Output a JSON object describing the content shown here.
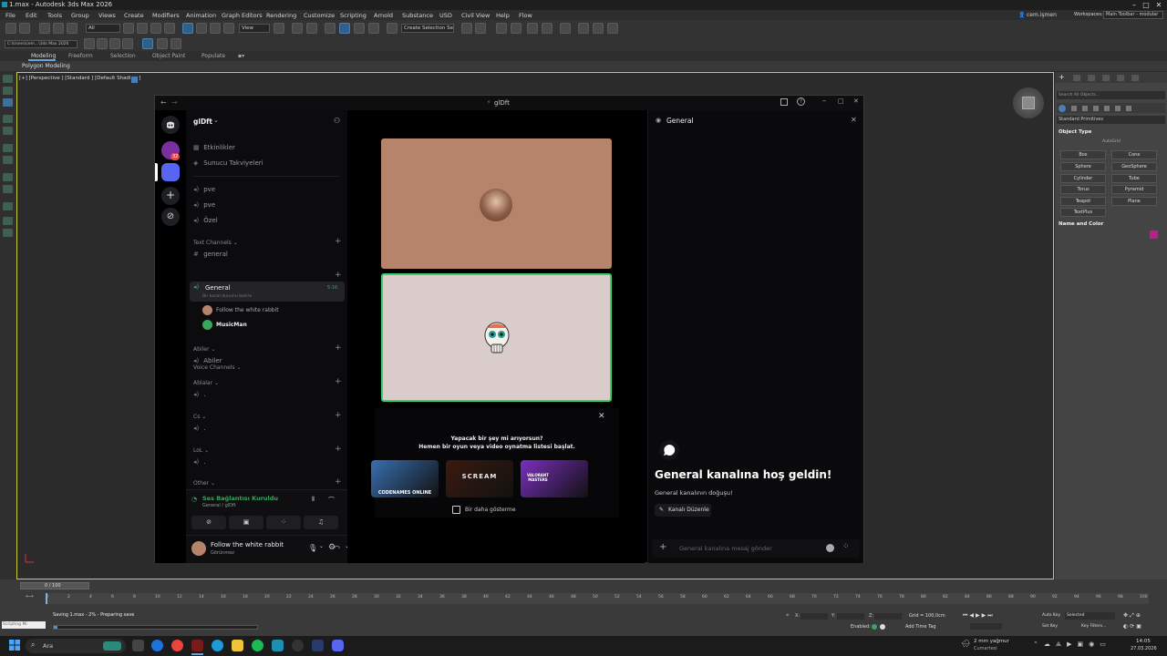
{
  "window": {
    "title": "1.max - Autodesk 3ds Max 2026",
    "minimize": "–",
    "maximize": "□",
    "close": "✕"
  },
  "menu": [
    "File",
    "Edit",
    "Tools",
    "Group",
    "Views",
    "Create",
    "Modifiers",
    "Animation",
    "Graph Editors",
    "Rendering",
    "Customize",
    "Scripting",
    "Arnold",
    "Substance",
    "USD",
    "Civil View",
    "Help",
    "Flow"
  ],
  "user": {
    "name": "cem.işmen",
    "workspaces_label": "Workspaces:",
    "workspace": "Main Toolbar - modular"
  },
  "toolbar": {
    "all_filter": "All",
    "view_dropdown": "View",
    "selection_set": "Create Selection Se",
    "path": "C:\\Users\\cem...\\3ds Max 2026"
  },
  "ribbon": {
    "tabs": [
      "Modeling",
      "Freeform",
      "Selection",
      "Object Paint",
      "Populate"
    ],
    "sub": "Polygon Modeling"
  },
  "viewport": {
    "label": "[+] [Perspective ] [Standard ] [Default Shading ]"
  },
  "command_panel": {
    "search_placeholder": "Search All Objects...",
    "category": "Standard Primitives",
    "object_type_title": "Object Type",
    "autogrid": "AutoGrid",
    "primitives": [
      "Box",
      "Cone",
      "Sphere",
      "GeoSphere",
      "Cylinder",
      "Tube",
      "Torus",
      "Pyramid",
      "Teapot",
      "Plane",
      "TextPlus"
    ],
    "name_color_title": "Name and Color",
    "color": "#c2199a"
  },
  "timeline": {
    "slider_label": "0 / 100",
    "ticks": [
      "0",
      "2",
      "4",
      "6",
      "8",
      "10",
      "12",
      "14",
      "16",
      "18",
      "20",
      "22",
      "24",
      "26",
      "28",
      "30",
      "32",
      "34",
      "36",
      "38",
      "40",
      "42",
      "44",
      "46",
      "48",
      "50",
      "52",
      "54",
      "56",
      "58",
      "60",
      "62",
      "64",
      "66",
      "68",
      "70",
      "72",
      "74",
      "76",
      "78",
      "80",
      "82",
      "84",
      "86",
      "88",
      "90",
      "92",
      "94",
      "96",
      "98",
      "100"
    ]
  },
  "status": {
    "scripting": "Scripting Mi",
    "saving": "Saving 1.max -  2% - Preparing save",
    "x_label": "X:",
    "y_label": "Y:",
    "z_label": "Z:",
    "grid": "Grid = 100,0cm",
    "enabled": "Enabled:",
    "add_time_tag": "Add Time Tag",
    "auto_key": "Auto Key",
    "set_key": "Set Key",
    "selected": "Selected",
    "key_filters": "Key Filters..."
  },
  "taskbar": {
    "search": "Ara",
    "weather": "2 mm yağmur",
    "weather_sub": "Cumartesi",
    "time": "14:05",
    "date": "27.03.2026"
  },
  "discord": {
    "title": "glDft",
    "server_name": "glDft",
    "badge": "32",
    "top_items": [
      {
        "icon": "calendar-icon",
        "label": "Etkinlikler"
      },
      {
        "icon": "boost-icon",
        "label": "Sunucu Takviyeleri"
      }
    ],
    "channels_top": [
      {
        "icon": "speaker-icon",
        "label": "pve"
      },
      {
        "icon": "speaker-icon",
        "label": "pve"
      },
      {
        "icon": "speaker-icon",
        "label": "Özel"
      }
    ],
    "text_category": "Text Channels",
    "text_channels": [
      "general"
    ],
    "voice_category": "Voice Channels",
    "voice_active": {
      "label": "General",
      "time": "5:16",
      "status": "Bir kanal durumu belirle"
    },
    "voice_members": [
      {
        "name": "Follow the white rabbit",
        "avatar_color": "#b5846b"
      },
      {
        "name": "MusicMan",
        "avatar_color": "#3ba55d"
      }
    ],
    "categories": [
      {
        "name": "Abiler",
        "channels": [
          "Abiler"
        ]
      },
      {
        "name": "Ablalar",
        "channels": [
          "."
        ]
      },
      {
        "name": "Cs",
        "channels": [
          "."
        ]
      },
      {
        "name": "LoL",
        "channels": [
          "."
        ]
      },
      {
        "name": "Other",
        "channels": []
      }
    ],
    "voice_panel": {
      "status": "Ses Bağlantısı Kuruldu",
      "sub": "General / glDft"
    },
    "user_panel": {
      "name": "Follow the white rabbit",
      "status": "Görünmez"
    },
    "activity": {
      "line1": "Yapacak bir şey mi arıyorsun?",
      "line2": "Hemen bir oyun veya video oynatma listesi başlat.",
      "games": [
        {
          "name": "CODENAMES ONLINE",
          "color": "#3a6fb0"
        },
        {
          "name": "SCREAM",
          "color": "#3b1a0f"
        },
        {
          "name": "VALORANT MASTERS",
          "color": "#7a2fbf"
        }
      ],
      "dont_show": "Bir daha gösterme"
    },
    "chat": {
      "channel": "General",
      "welcome": "General kanalına hoş geldin!",
      "sub": "General kanalının doğuşu!",
      "edit_button": "Kanalı Düzenle",
      "input_placeholder": "General kanalına mesaj gönder"
    }
  }
}
